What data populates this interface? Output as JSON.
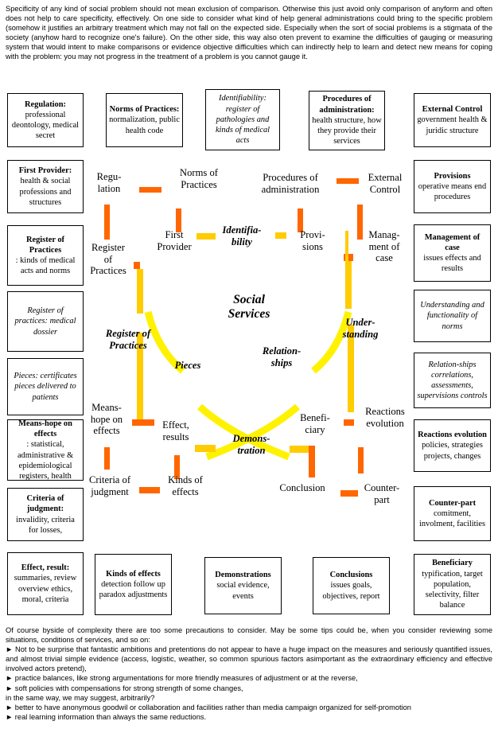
{
  "intro_paragraph": "Specificity of any kind of social problem should not mean exclusion of comparison. Otherwise this just avoid only comparison of anyform and often does not help to care specificity, effectively. On one side to consider what kind of help general administrations could bring to the specific problem (somehow it justifies an arbitrary treatment which may not fall on the expected side. Especially when the sort of social problems is a stigmata of the society (anyhow hard to recognize one's failure). On the other side, this way also oten prevent to examine the difficulties of gauging or measuring system that would intent to make comparisons or evidence objective difficulties which can indirectly help to learn and detect new means for coping with the problem: you may not progress in the treatment of a problem is you cannot gauge it.",
  "outro": {
    "lead": "Of course byside of complexity there are too some precautions to consider. May be some tips could be, when you consider reviewing some situations, conditions of services, and so on:",
    "bullets": [
      "Not to be surprise that fantastic ambitions and pretentions do not appear to have a huge impact on the measures and seriously quantified issues, and almost trivial simple evidence (access, logistic, weather, so common spurious factors asimportant as the extraordinary efficiency and effective involved actors pretend),",
      "practice balances, like strong argumentations for more friendly measures of adjustment or at the reverse,",
      "soft policies with compensations for strong strength of some changes,"
    ],
    "mid_line": "in the same way, we may suggest, arbitrarily?",
    "bullets2": [
      "better to have anonymous goodwil or collaboration and facilities rather than media campaign organized for self-promotion",
      "real learning information than always the same reductions."
    ]
  },
  "colors": {
    "orange": "#FF6600",
    "gold": "#FFCC00",
    "yellow": "#FFF200",
    "border": "#000000",
    "background": "#FFFFFF"
  },
  "boxes": {
    "regulation": {
      "title": "Regulation:",
      "body": "professional deontology, medical secret"
    },
    "norms_of_practices": {
      "title": "Norms of Practices:",
      "body": "normalization, public health code"
    },
    "identifiability": {
      "title": "",
      "body": "Identifiability: register of pathologies and kinds of medical acts"
    },
    "procedures_of_administration": {
      "title": "Procedures of administration:",
      "body": "health structure, how they provide their services"
    },
    "external_control": {
      "title": "External Control",
      "body": "government health & juridic structure"
    },
    "first_provider": {
      "title": "First Provider:",
      "body": "health & social professions and structures"
    },
    "provisions": {
      "title": "Provisions",
      "body": "operative means end procedures"
    },
    "register_of_practices_kinds": {
      "title": "Register of Practices",
      "body": ": kinds of medical acts and norms"
    },
    "management_of_case": {
      "title": "Management of case",
      "body": " issues effects and results"
    },
    "register_of_practices_dossier": {
      "title": "",
      "body": "Register of practices: medical dossier"
    },
    "understanding_norms": {
      "title": "",
      "body": "Understanding and functionality of norms"
    },
    "pieces": {
      "title": "",
      "body": "Pieces: certificates pieces delivered to patients"
    },
    "relationships_box": {
      "title": "",
      "body": "Relation-ships correlations, assessments, supervisions controls"
    },
    "means_hope": {
      "title": "Means-hope on effects",
      "body": ": statistical, administrative & epidemiological registers, health"
    },
    "reactions_evolution": {
      "title": "Reactions evolution",
      "body": "policies, strategies projects, changes"
    },
    "criteria_of_judgment": {
      "title": "Criteria of judgment:",
      "body": "invalidity, criteria for losses,"
    },
    "counter_part": {
      "title": "Counter-part",
      "body": "comitment, involment, facilities"
    },
    "effect_result": {
      "title": "Effect, result:",
      "body": "summaries, review overview ethics, moral, criteria"
    },
    "kinds_of_effects": {
      "title": "Kinds of effects",
      "body": "detection follow up paradox adjustments"
    },
    "demonstrations": {
      "title": "Demonstrations",
      "body": "social evidence, events"
    },
    "conclusions": {
      "title": "Conclusions",
      "body": " issues goals, objectives, report"
    },
    "beneficiary_box": {
      "title": "Beneficiary",
      "body": "typification, target population, selectivity, filter balance"
    }
  },
  "diagram": {
    "center": "Social\nServices",
    "nodes": [
      {
        "key": "regulation",
        "label": "Regu-\nlation"
      },
      {
        "key": "norms",
        "label": "Norms of\nPractices"
      },
      {
        "key": "procedures",
        "label": "Procedures of\nadministration"
      },
      {
        "key": "external_control",
        "label": "External\nControl"
      },
      {
        "key": "register",
        "label": "Register\nof\nPractices"
      },
      {
        "key": "first_provider",
        "label": "First\nProvider"
      },
      {
        "key": "identifiability",
        "label": "Identifia-\nbility"
      },
      {
        "key": "provisions",
        "label": "Provi-\nsions"
      },
      {
        "key": "management",
        "label": "Manag-\nment of\ncase"
      },
      {
        "key": "register_italic",
        "label": "Register of\nPractices"
      },
      {
        "key": "understanding",
        "label": "Under-\nstanding"
      },
      {
        "key": "pieces",
        "label": "Pieces"
      },
      {
        "key": "relationships",
        "label": "Relation-\nships"
      },
      {
        "key": "means_hope",
        "label": "Means-\nhope on\neffects"
      },
      {
        "key": "effect_results",
        "label": "Effect,\nresults"
      },
      {
        "key": "demonstration",
        "label": "Demons-\ntration"
      },
      {
        "key": "beneficiary",
        "label": "Benefi-\nciary"
      },
      {
        "key": "reactions",
        "label": "Reactions\nevolution"
      },
      {
        "key": "criteria",
        "label": "Criteria of\njudgment"
      },
      {
        "key": "kinds_effects",
        "label": "Kinds of\neffects"
      },
      {
        "key": "conclusion",
        "label": "Conclusion"
      },
      {
        "key": "counterpart",
        "label": "Counter-\npart"
      }
    ]
  }
}
